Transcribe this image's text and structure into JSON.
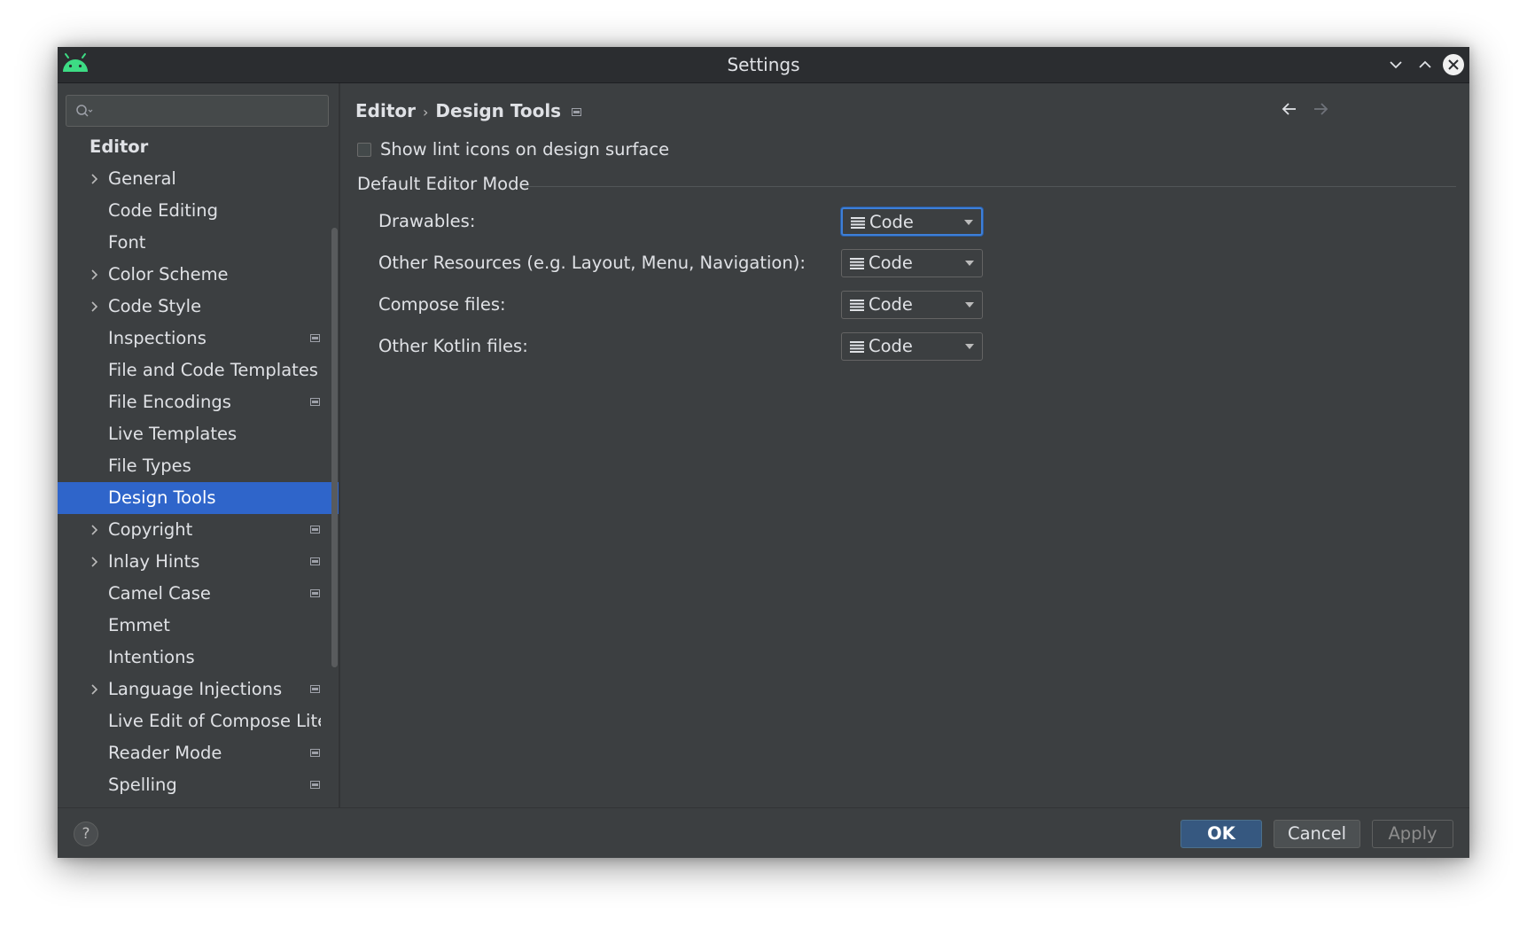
{
  "window": {
    "title": "Settings"
  },
  "search": {
    "value": "",
    "placeholder": ""
  },
  "sidebar": {
    "root_label": "Editor",
    "items": [
      {
        "label": "General",
        "expandable": true,
        "project_scope": false,
        "selected": false
      },
      {
        "label": "Code Editing",
        "expandable": false,
        "project_scope": false,
        "selected": false
      },
      {
        "label": "Font",
        "expandable": false,
        "project_scope": false,
        "selected": false
      },
      {
        "label": "Color Scheme",
        "expandable": true,
        "project_scope": false,
        "selected": false
      },
      {
        "label": "Code Style",
        "expandable": true,
        "project_scope": false,
        "selected": false
      },
      {
        "label": "Inspections",
        "expandable": false,
        "project_scope": true,
        "selected": false
      },
      {
        "label": "File and Code Templates",
        "expandable": false,
        "project_scope": false,
        "selected": false
      },
      {
        "label": "File Encodings",
        "expandable": false,
        "project_scope": true,
        "selected": false
      },
      {
        "label": "Live Templates",
        "expandable": false,
        "project_scope": false,
        "selected": false
      },
      {
        "label": "File Types",
        "expandable": false,
        "project_scope": false,
        "selected": false
      },
      {
        "label": "Design Tools",
        "expandable": false,
        "project_scope": false,
        "selected": true
      },
      {
        "label": "Copyright",
        "expandable": true,
        "project_scope": true,
        "selected": false
      },
      {
        "label": "Inlay Hints",
        "expandable": true,
        "project_scope": true,
        "selected": false
      },
      {
        "label": "Camel Case",
        "expandable": false,
        "project_scope": true,
        "selected": false
      },
      {
        "label": "Emmet",
        "expandable": false,
        "project_scope": false,
        "selected": false
      },
      {
        "label": "Intentions",
        "expandable": false,
        "project_scope": false,
        "selected": false
      },
      {
        "label": "Language Injections",
        "expandable": true,
        "project_scope": true,
        "selected": false
      },
      {
        "label": "Live Edit of Compose Liter",
        "expandable": false,
        "project_scope": false,
        "selected": false
      },
      {
        "label": "Reader Mode",
        "expandable": false,
        "project_scope": true,
        "selected": false
      },
      {
        "label": "Spelling",
        "expandable": false,
        "project_scope": true,
        "selected": false
      }
    ]
  },
  "breadcrumb": {
    "parent": "Editor",
    "separator": "›",
    "current": "Design Tools"
  },
  "lint_option": {
    "label": "Show lint icons on design surface",
    "checked": false
  },
  "group": {
    "title": "Default Editor Mode"
  },
  "fields": [
    {
      "label": "Drawables:",
      "value": "Code"
    },
    {
      "label": "Other Resources (e.g. Layout, Menu, Navigation):",
      "value": "Code"
    },
    {
      "label": "Compose files:",
      "value": "Code"
    },
    {
      "label": "Other Kotlin files:",
      "value": "Code"
    }
  ],
  "buttons": {
    "help": "?",
    "ok": "OK",
    "cancel": "Cancel",
    "apply": "Apply"
  },
  "colors": {
    "background": "#3c3f41",
    "selection": "#2f65ca",
    "ok_button": "#365880",
    "focus_ring": "#3d7fd9",
    "android_logo": "#3ddc84"
  },
  "icons": {
    "app": "android-logo-icon",
    "minimize": "chevron-down-icon",
    "maximize": "chevron-up-icon",
    "close": "close-icon",
    "back": "arrow-left-icon",
    "forward": "arrow-right-icon",
    "search": "search-icon",
    "project_scope": "project-scope-icon",
    "combo_mode": "code-lines-icon"
  }
}
